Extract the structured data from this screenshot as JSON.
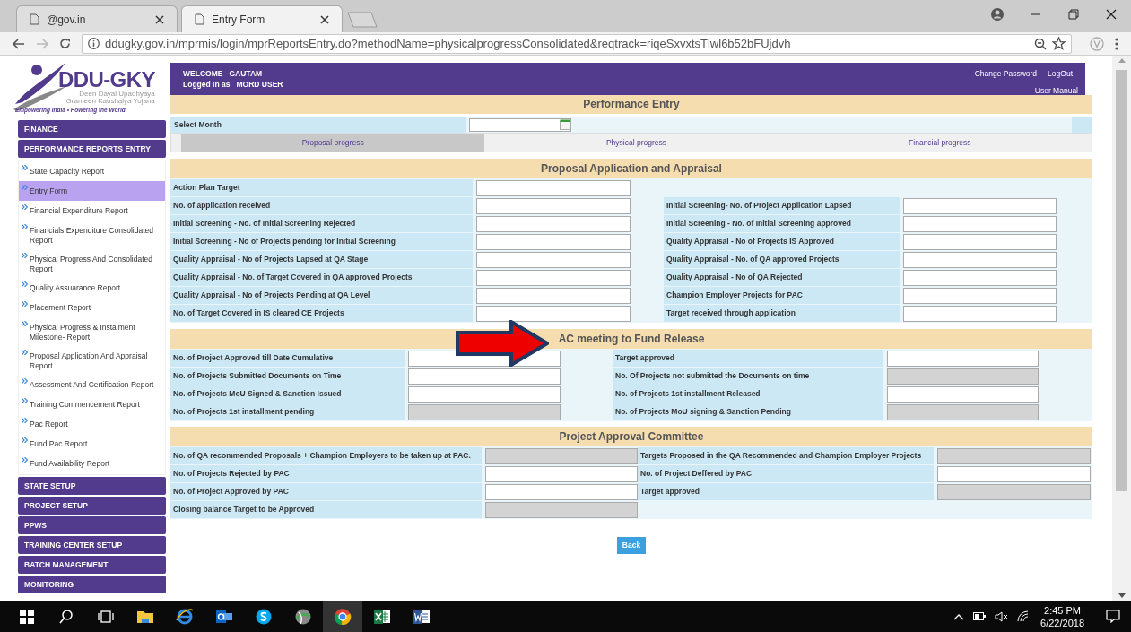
{
  "browser": {
    "tabs": [
      {
        "title": "@gov.in",
        "selected": false
      },
      {
        "title": "Entry Form",
        "selected": true
      }
    ],
    "url": "ddugky.gov.in/mprmis/login/mprReportsEntry.do?methodName=physicalprogressConsolidated&reqtrack=riqeSxvxtsTlwl6b52bFUjdvh"
  },
  "logo": {
    "name": "DDU-GKY",
    "line_1": "Deen Dayal Upadhyaya",
    "line_2": "Grameen Kaushalya Yojana",
    "tagline": "Empowering India • Powering the World"
  },
  "sidebar": [
    {
      "label": "FINANCE"
    },
    {
      "label": "PERFORMANCE REPORTS ENTRY",
      "children": [
        {
          "label": "State Capacity Report",
          "selected": false
        },
        {
          "label": "Entry Form",
          "selected": true
        },
        {
          "label": "Financial Expenditure Report",
          "selected": false
        },
        {
          "label": "Financials Expenditure Consolidated Report",
          "selected": false
        },
        {
          "label": "Physical Progress And Consolidated Report",
          "selected": false
        },
        {
          "label": "Quality Assuarance Report",
          "selected": false
        },
        {
          "label": "Placement Report",
          "selected": false
        },
        {
          "label": "Physical Progress & Instalment Milestone- Report",
          "selected": false
        },
        {
          "label": "Proposal Application And Appraisal Report",
          "selected": false
        },
        {
          "label": "Assessment And Certification Report",
          "selected": false
        },
        {
          "label": "Training Commencement Report",
          "selected": false
        },
        {
          "label": "Pac Report",
          "selected": false
        },
        {
          "label": "Fund Pac Report",
          "selected": false
        },
        {
          "label": "Fund Availability Report",
          "selected": false
        }
      ]
    },
    {
      "label": "STATE SETUP"
    },
    {
      "label": "PROJECT SETUP"
    },
    {
      "label": "PPWS"
    },
    {
      "label": "TRAINING CENTER SETUP"
    },
    {
      "label": "BATCH MANAGEMENT"
    },
    {
      "label": "MONITORING"
    }
  ],
  "header": {
    "welcome": "WELCOME   GAUTAM",
    "logged_in": "Logged In as   MORD USER",
    "links": [
      "Change Password",
      "LogOut"
    ],
    "user_manual": "User Manual"
  },
  "title": "Performance Entry",
  "select_month": {
    "label": "Select Month"
  },
  "progress_tabs": [
    {
      "label": "Proposal progress",
      "selected": true
    },
    {
      "label": "Physical progress",
      "selected": false
    },
    {
      "label": "Financial progress",
      "selected": false
    }
  ],
  "sections": [
    {
      "title": "Proposal Application and Appraisal",
      "rows": [
        {
          "left": {
            "label": "Action Plan Target",
            "disabled": false
          }
        },
        {
          "left": {
            "label": "No. of application received",
            "disabled": false
          },
          "right": {
            "label": "Initial Screening- No. of Project Application Lapsed",
            "disabled": false
          }
        },
        {
          "left": {
            "label": "Initial Screening - No. of Initial Screening Rejected",
            "disabled": false
          },
          "right": {
            "label": "Initial Screening - No. of Initial Screening approved",
            "disabled": false
          }
        },
        {
          "left": {
            "label": "Initial Screening - No of Projects pending for Initial Screening",
            "disabled": false
          },
          "right": {
            "label": "Quality Appraisal - No of Projects IS Approved",
            "disabled": false
          }
        },
        {
          "left": {
            "label": "Quality Appraisal - No of Projects Lapsed at QA Stage",
            "disabled": false
          },
          "right": {
            "label": "Quality Appraisal - No. of QA approved Projects",
            "disabled": false
          }
        },
        {
          "left": {
            "label": "Quality Appraisal - No. of Target Covered in QA approved Projects",
            "disabled": false
          },
          "right": {
            "label": "Quality Appraisal - No of QA Rejected",
            "disabled": false
          }
        },
        {
          "left": {
            "label": "Quality Appraisal - No of Projects Pending at QA Level",
            "disabled": false
          },
          "right": {
            "label": "Champion Employer Projects for PAC",
            "disabled": false
          }
        },
        {
          "left": {
            "label": "No. of Target Covered in IS cleared CE Projects",
            "disabled": false
          },
          "right": {
            "label": "Target received through application",
            "disabled": false
          }
        }
      ]
    },
    {
      "title": "AC meeting to Fund Release",
      "rows": [
        {
          "left": {
            "label": "No. of Project Approved till Date Cumulative",
            "disabled": false
          },
          "right": {
            "label": "Target approved",
            "disabled": false
          }
        },
        {
          "left": {
            "label": "No. of Projects Submitted Documents on Time",
            "disabled": false
          },
          "right": {
            "label": "No. Of Projects not submitted the Documents on time",
            "disabled": true
          }
        },
        {
          "left": {
            "label": "No. of Projects MoU Signed & Sanction Issued",
            "disabled": false
          },
          "right": {
            "label": "No. of Projects 1st installment Released",
            "disabled": false
          }
        },
        {
          "left": {
            "label": "No. of Projects 1st installment pending",
            "disabled": true
          },
          "right": {
            "label": "No. of Projects MoU signing & Sanction Pending",
            "disabled": true
          }
        }
      ]
    },
    {
      "title": "Project Approval Committee",
      "rows": [
        {
          "left": {
            "label": "No. of QA recommended Proposals + Champion Employers to be taken up at PAC.",
            "disabled": true
          },
          "right": {
            "label": "Targets Proposed in the QA Recommended and Champion Employer Projects",
            "disabled": true
          }
        },
        {
          "left": {
            "label": "No. of Projects Rejected by PAC",
            "disabled": false
          },
          "right": {
            "label": "No. of Project Deffered by PAC",
            "disabled": false
          }
        },
        {
          "left": {
            "label": "No. of Project Approved by PAC",
            "disabled": false
          },
          "right": {
            "label": "Target approved",
            "disabled": true
          }
        },
        {
          "left": {
            "label": "Closing balance Target to be Approved",
            "disabled": true
          }
        }
      ]
    }
  ],
  "back_button": "Back",
  "taskbar": {
    "time": "2:45 PM",
    "date": "6/22/2018"
  }
}
